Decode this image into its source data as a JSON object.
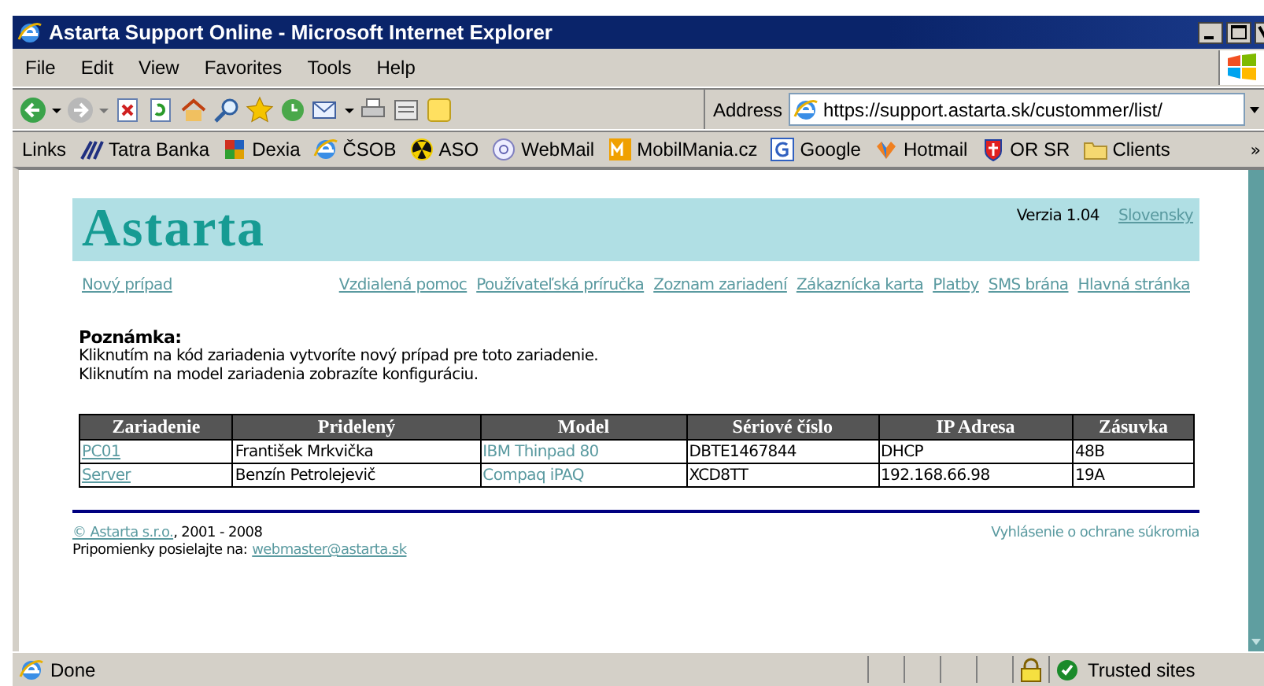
{
  "window": {
    "title": "Astarta Support Online - Microsoft Internet Explorer"
  },
  "menu": [
    "File",
    "Edit",
    "View",
    "Favorites",
    "Tools",
    "Help"
  ],
  "address": {
    "label": "Address",
    "value": "https://support.astarta.sk/custommer/list/"
  },
  "links": {
    "label": "Links",
    "items": [
      "Tatra Banka",
      "Dexia",
      "ČSOB",
      "ASO",
      "WebMail",
      "MobilMania.cz",
      "Google",
      "Hotmail",
      "OR SR",
      "Clients"
    ],
    "more": "»"
  },
  "page": {
    "brand": "Astarta",
    "version": "Verzia 1.04",
    "language": "Slovensky",
    "nav_left": "Nový prípad",
    "nav": [
      "Vzdialená pomoc",
      "Používateľská príručka",
      "Zoznam zariadení",
      "Zákaznícka karta",
      "Platby",
      "SMS brána",
      "Hlavná stránka"
    ],
    "note_title": "Poznámka:",
    "note_lines": [
      "Kliknutím na kód zariadenia vytvoríte nový prípad pre toto zariadenie.",
      "Kliknutím na model zariadenia zobrazíte konfiguráciu."
    ],
    "table": {
      "columns": [
        {
          "label": "Zariadenie",
          "kind": "link"
        },
        {
          "label": "Pridelený",
          "kind": "text"
        },
        {
          "label": "Model",
          "kind": "plain-link"
        },
        {
          "label": "Sériové číslo",
          "kind": "text"
        },
        {
          "label": "IP Adresa",
          "kind": "text"
        },
        {
          "label": "Zásuvka",
          "kind": "text"
        }
      ],
      "rows": [
        [
          "PC01",
          "František Mrkvička",
          "IBM Thinpad 80",
          "DBTE1467844",
          "DHCP",
          "48B"
        ],
        [
          "Server",
          "Benzín Petrolejevič",
          "Compaq iPAQ",
          "XCD8TT",
          "192.168.66.98",
          "19A"
        ]
      ]
    },
    "footer": {
      "copyright_link": "© Astarta s.r.o.",
      "copyright_years": ", 2001 - 2008",
      "contact_label": "Pripomienky posielajte na:",
      "contact_email": "webmaster@astarta.sk",
      "privacy": "Vyhlásenie o ochrane súkromia"
    }
  },
  "status_bar": {
    "text": "Done",
    "zone": "Trusted sites"
  }
}
